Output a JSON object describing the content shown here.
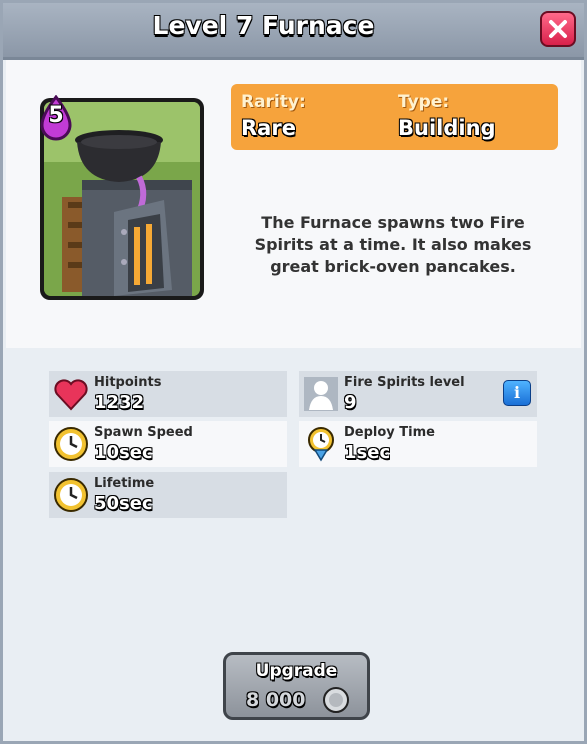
{
  "header": {
    "title": "Level 7 Furnace"
  },
  "card": {
    "elixir_cost": "5",
    "name_icon": "furnace-card-art"
  },
  "info": {
    "rarity_label": "Rarity:",
    "rarity_value": "Rare",
    "type_label": "Type:",
    "type_value": "Building"
  },
  "description": "The Furnace spawns two Fire Spirits at a time. It also makes great brick-oven pancakes.",
  "stats": [
    {
      "label": "Hitpoints",
      "value": "1232",
      "icon": "heart-icon"
    },
    {
      "label": "Fire Spirits level",
      "value": "9",
      "icon": "troop-silhouette-icon"
    },
    {
      "label": "Spawn Speed",
      "value": "10sec",
      "icon": "clock-icon"
    },
    {
      "label": "Deploy Time",
      "value": "1sec",
      "icon": "deploy-clock-icon"
    },
    {
      "label": "Lifetime",
      "value": "50sec",
      "icon": "clock-icon"
    }
  ],
  "info_button": {
    "glyph": "i"
  },
  "upgrade": {
    "label": "Upgrade",
    "cost": "8 000",
    "currency_icon": "coin-icon"
  },
  "colors": {
    "orange": "#f6a33c",
    "close_red": "#d9204a",
    "info_blue": "#1a6fd6"
  }
}
